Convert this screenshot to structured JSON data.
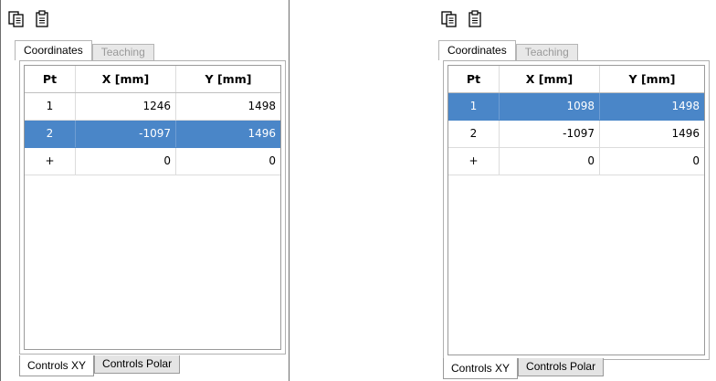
{
  "colors": {
    "selection": "#4a86c8",
    "selection_text": "#ffffff"
  },
  "toolbar": {
    "icons": [
      "copy-icon",
      "paste-clipboard-icon"
    ]
  },
  "tabs": {
    "coordinates": "Coordinates",
    "teaching": "Teaching"
  },
  "bottom_tabs": {
    "controls_xy": "Controls XY",
    "controls_polar": "Controls Polar"
  },
  "grid": {
    "headers": {
      "pt": "Pt",
      "x": "X [mm]",
      "y": "Y [mm]"
    }
  },
  "left_panel": {
    "selected_row": 1,
    "rows": [
      {
        "pt": "1",
        "x": "1246",
        "y": "1498"
      },
      {
        "pt": "2",
        "x": "-1097",
        "y": "1496"
      },
      {
        "pt": "+",
        "x": "0",
        "y": "0"
      }
    ]
  },
  "right_panel": {
    "selected_row": 0,
    "rows": [
      {
        "pt": "1",
        "x": "1098",
        "y": "1498"
      },
      {
        "pt": "2",
        "x": "-1097",
        "y": "1496"
      },
      {
        "pt": "+",
        "x": "0",
        "y": "0"
      }
    ]
  }
}
